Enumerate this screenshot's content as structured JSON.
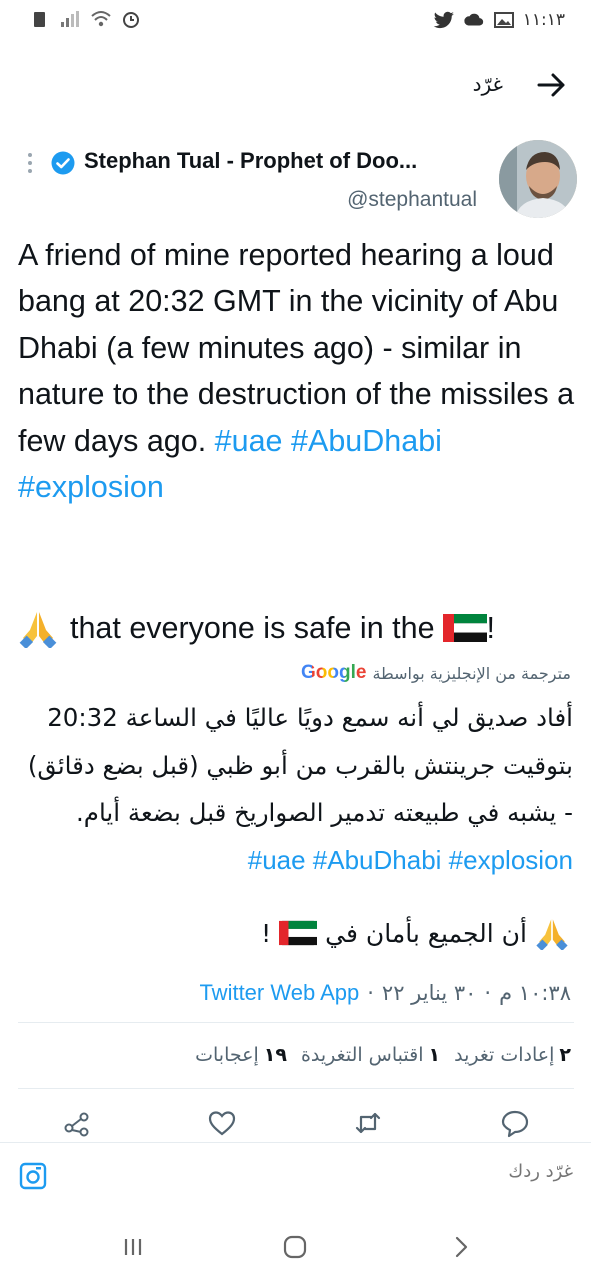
{
  "status_bar": {
    "time": "١١:١٣",
    "left_icons": [
      "sim-icon",
      "signal-icon",
      "wifi-icon",
      "alarm-icon"
    ],
    "right_icons": [
      "twitter-bird-icon",
      "cloud-icon",
      "image-icon"
    ]
  },
  "header": {
    "title": "غرّد"
  },
  "tweet": {
    "display_name": "Stephan Tual - Prophet of Doo...",
    "handle": "@stephantual",
    "text_parts": {
      "main": "A friend of mine reported hearing a loud bang at 20:32 GMT in the vicinity of Abu Dhabi (a few minutes ago) - similar in nature to the destruction of the missiles a few days ago. ",
      "tag1": "#uae",
      "tag2": "#AbuDhabi",
      "tag3": "#explosion"
    },
    "prayer_text": "that everyone is safe in the",
    "prayer_end": "!"
  },
  "translation": {
    "label": "مترجمة من الإنجليزية بواسطة",
    "provider": "Google",
    "text": "أفاد صديق لي أنه سمع دويًا عاليًا في الساعة 20:32 بتوقيت جرينتش بالقرب من أبو ظبي (قبل بضع دقائق) - يشبه في طبيعته تدمير الصواريخ قبل بضعة أيام. ",
    "tags": "#uae #AbuDhabi #explosion",
    "prayer_text": "أن الجميع بأمان في",
    "prayer_end": "!"
  },
  "meta": {
    "time": "١٠:٣٨ م",
    "date": "٣٠ يناير ٢٢",
    "separator": "·",
    "client": "Twitter Web App"
  },
  "stats": {
    "retweets_count": "٢",
    "retweets_label": "إعادات تغريد",
    "quotes_count": "١",
    "quotes_label": "اقتباس التغريدة",
    "likes_count": "١٩",
    "likes_label": "إعجابات"
  },
  "reply": {
    "placeholder": "غرّد ردك"
  },
  "colors": {
    "accent": "#1d9bf0",
    "text": "#0f1419",
    "muted": "#536471"
  }
}
